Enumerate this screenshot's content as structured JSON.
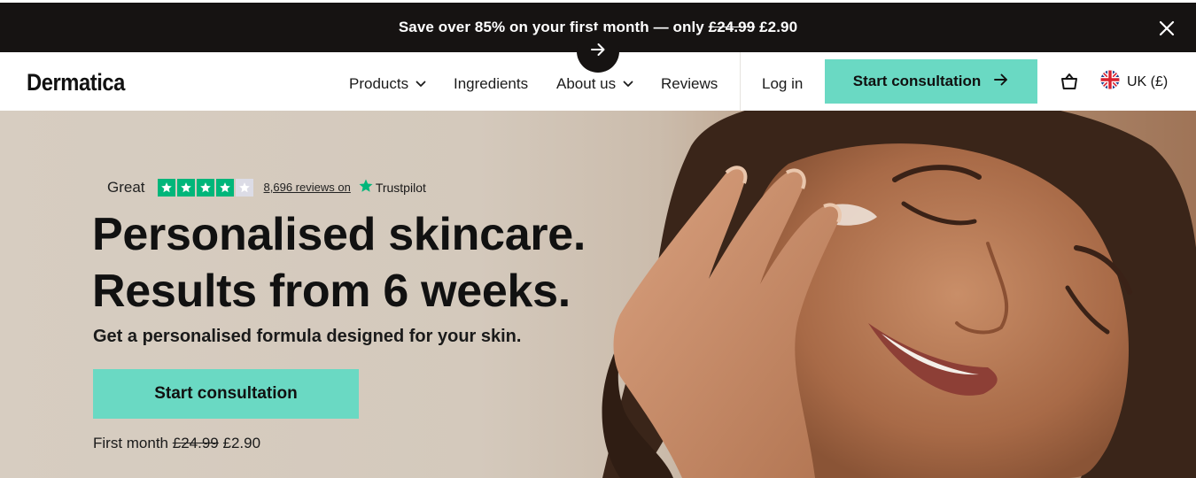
{
  "promo": {
    "text_prefix": "Save over 85% on your first month — only ",
    "old_price": "£24.99",
    "new_price": "£2.90"
  },
  "nav": {
    "logo": "Dermatica",
    "items": [
      {
        "label": "Products",
        "has_dropdown": true
      },
      {
        "label": "Ingredients",
        "has_dropdown": false
      },
      {
        "label": "About us",
        "has_dropdown": true
      },
      {
        "label": "Reviews",
        "has_dropdown": false
      }
    ],
    "login": "Log in",
    "cta": "Start consultation",
    "locale": "UK (£)"
  },
  "hero": {
    "rating_word": "Great",
    "stars_filled": 4,
    "stars_total": 5,
    "reviews_link": "8,696 reviews on",
    "trustpilot": "Trustpilot",
    "headline_line1": "Personalised skincare.",
    "headline_line2": "Results from 6 weeks.",
    "subhead": "Get a personalised formula designed for your skin.",
    "cta": "Start consultation",
    "price_prefix": "First month",
    "old_price": "£24.99",
    "new_price": "£2.90"
  },
  "colors": {
    "accent": "#6ad9c3",
    "banner": "#161312",
    "trustpilot_green": "#00b67a"
  },
  "icons": [
    "close-icon",
    "arrow-right-icon",
    "chevron-down-icon",
    "basket-icon",
    "uk-flag-icon",
    "star-icon"
  ]
}
